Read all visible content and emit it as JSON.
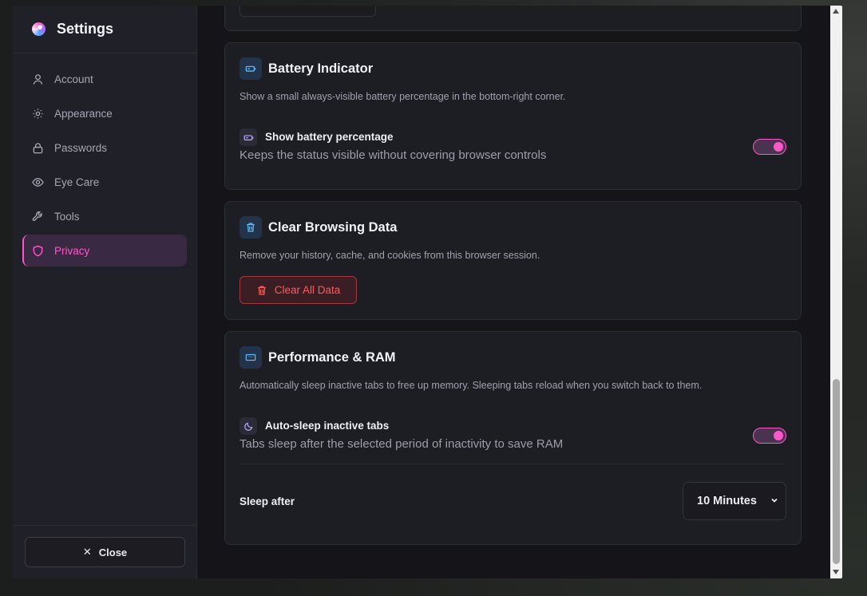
{
  "sidebar": {
    "title": "Settings",
    "items": [
      {
        "label": "Account",
        "icon": "user-icon",
        "active": false
      },
      {
        "label": "Appearance",
        "icon": "sun-icon",
        "active": false
      },
      {
        "label": "Passwords",
        "icon": "lock-icon",
        "active": false
      },
      {
        "label": "Eye Care",
        "icon": "eye-icon",
        "active": false
      },
      {
        "label": "Tools",
        "icon": "wrench-icon",
        "active": false
      },
      {
        "label": "Privacy",
        "icon": "shield-icon",
        "active": true
      }
    ],
    "close_label": "Close"
  },
  "battery": {
    "title": "Battery Indicator",
    "description": "Show a small always-visible battery percentage in the bottom-right corner.",
    "setting_label": "Show battery percentage",
    "setting_sub": "Keeps the status visible without covering browser controls",
    "enabled": true
  },
  "clear_data": {
    "title": "Clear Browsing Data",
    "description": "Remove your history, cache, and cookies from this browser session.",
    "button_label": "Clear All Data"
  },
  "performance": {
    "title": "Performance & RAM",
    "description": "Automatically sleep inactive tabs to free up memory. Sleeping tabs reload when you switch back to them.",
    "setting_label": "Auto-sleep inactive tabs",
    "setting_sub": "Tabs sleep after the selected period of inactivity to save RAM",
    "enabled": true,
    "sleep_label": "Sleep after",
    "sleep_value": "10 Minutes"
  },
  "colors": {
    "accent": "#ff56c8",
    "danger": "#ff5b5b",
    "background": "#141419",
    "sidebar": "#202028"
  }
}
